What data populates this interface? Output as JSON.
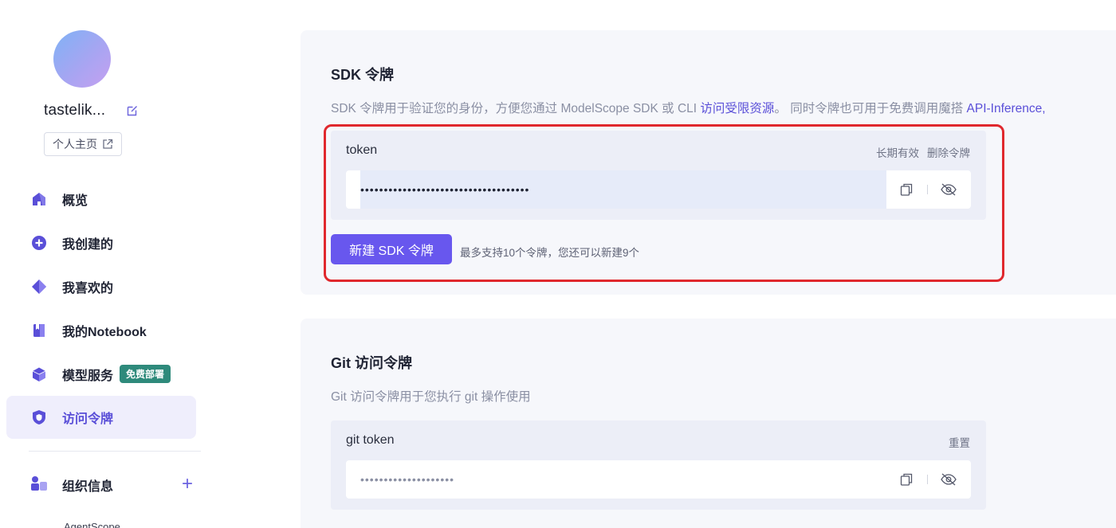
{
  "sidebar": {
    "username": "tastelik...",
    "home_button": "个人主页",
    "items": [
      {
        "label": "概览"
      },
      {
        "label": "我创建的"
      },
      {
        "label": "我喜欢的"
      },
      {
        "label": "我的Notebook"
      },
      {
        "label": "模型服务",
        "badge": "免费部署"
      },
      {
        "label": "访问令牌"
      }
    ],
    "org": {
      "label": "组织信息",
      "sub_item": "AgentScope"
    }
  },
  "sdk_section": {
    "title": "SDK 令牌",
    "description_prefix": "SDK 令牌用于验证您的身份，方便您通过 ModelScope SDK 或 CLI ",
    "description_link1": "访问受限资源",
    "description_middle": "。 同时令牌也可用于免费调用魔搭 ",
    "description_link2": "API-Inference,",
    "token": {
      "name": "token",
      "validity": "长期有效",
      "delete_label": "删除令牌",
      "masked_value": "••••••••••••••••••••••••••••••••••••"
    },
    "new_button": "新建 SDK 令牌",
    "hint": "最多支持10个令牌，您还可以新建9个"
  },
  "git_section": {
    "title": "Git 访问令牌",
    "description": "Git 访问令牌用于您执行 git 操作使用",
    "token": {
      "name": "git token",
      "reset_label": "重置",
      "masked_value": "••••••••••••••••••••"
    }
  },
  "colors": {
    "accent": "#6857ee",
    "badge": "#2e8a7b",
    "highlight": "#e0282d"
  }
}
